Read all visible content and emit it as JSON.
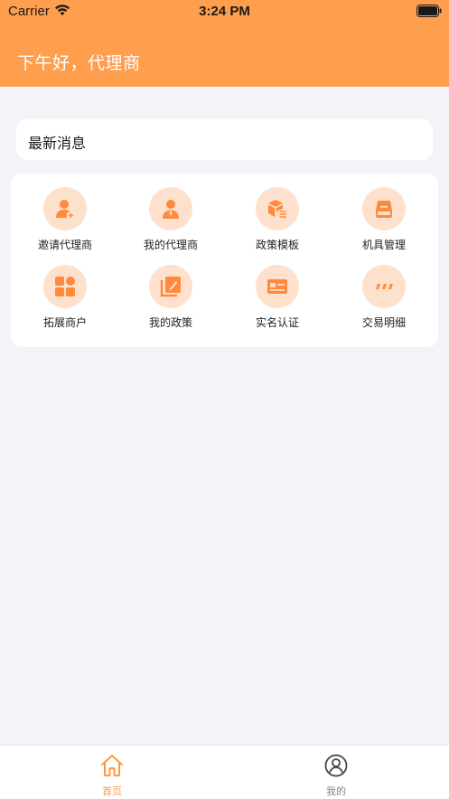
{
  "status_bar": {
    "carrier": "Carrier",
    "time": "3:24 PM"
  },
  "header": {
    "greeting": "下午好，代理商"
  },
  "news": {
    "title": "最新消息"
  },
  "grid": {
    "items": [
      {
        "label": "邀请代理商",
        "icon": "invite-agent-icon"
      },
      {
        "label": "我的代理商",
        "icon": "my-agent-icon"
      },
      {
        "label": "政策模板",
        "icon": "policy-template-icon"
      },
      {
        "label": "机具管理",
        "icon": "device-management-icon"
      },
      {
        "label": "拓展商户",
        "icon": "expand-merchant-icon"
      },
      {
        "label": "我的政策",
        "icon": "my-policy-icon"
      },
      {
        "label": "实名认证",
        "icon": "real-name-auth-icon"
      },
      {
        "label": "交易明细",
        "icon": "transaction-details-icon"
      }
    ]
  },
  "tab_bar": {
    "tabs": [
      {
        "label": "首页",
        "icon": "home-icon",
        "active": true
      },
      {
        "label": "我的",
        "icon": "profile-icon",
        "active": false
      }
    ]
  },
  "colors": {
    "header": "#ff9f4d",
    "accent": "#ff9a3c",
    "icon_bg": "#fde1cc",
    "icon_fg": "#ff8a3d",
    "background": "#f3f4f8"
  }
}
